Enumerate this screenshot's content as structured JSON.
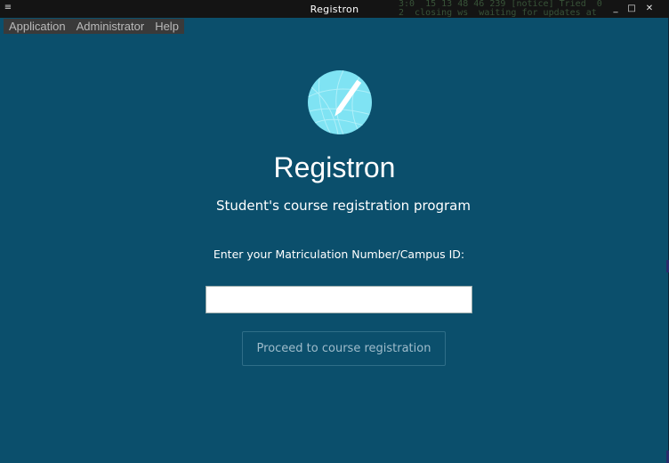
{
  "window": {
    "title": "Registron",
    "menu_glyph": "≡",
    "controls": {
      "minimize": "_",
      "maximize": "□",
      "close": "✕"
    },
    "background_color": "#0b4f6c"
  },
  "menubar": {
    "items": [
      {
        "label": "Application"
      },
      {
        "label": "Administrator"
      },
      {
        "label": "Help"
      }
    ]
  },
  "background_terminal": {
    "line1": "3:0  15 13 48 46 239 [notice] Tried  0 ",
    "line2": "2  closing ws  waiting for updates at "
  },
  "logo": {
    "icon": "pen-globe-icon",
    "color": "#7fe3f3"
  },
  "main": {
    "title": "Registron",
    "subtitle": "Student's course registration program",
    "id_label": "Enter your Matriculation Number/Campus ID:",
    "id_value": "",
    "id_placeholder": "",
    "proceed_label": "Proceed to course registration"
  }
}
